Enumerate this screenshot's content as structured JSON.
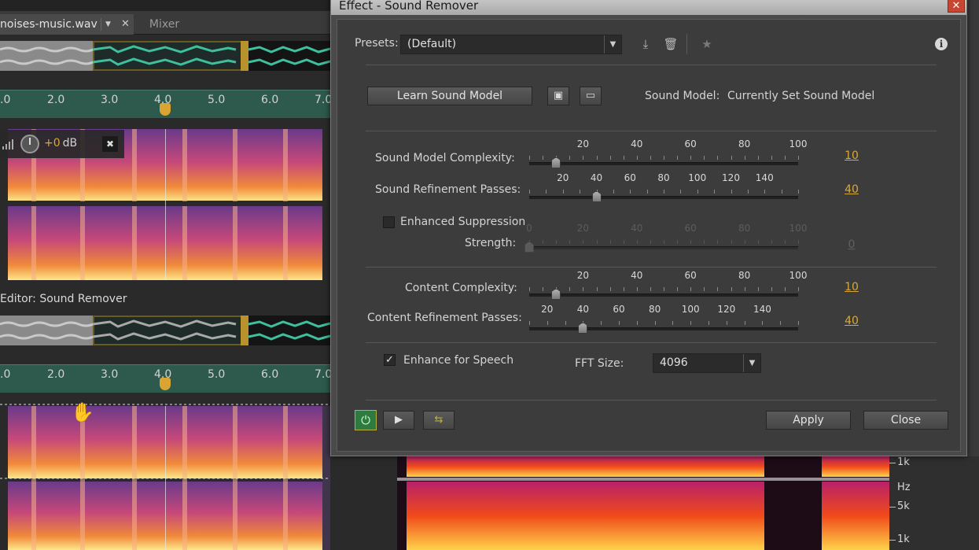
{
  "editor": {
    "file_tab": "noises-music.wav",
    "mixer_tab": "Mixer",
    "panel_title": "Editor: Sound Remover",
    "volume_value": "+0",
    "volume_unit": "dB",
    "ruler_ticks": [
      ".0",
      "2.0",
      "3.0",
      "4.0",
      "5.0",
      "6.0",
      "7.0"
    ],
    "hz_scale": {
      "unit": "Hz",
      "labels": [
        "1k",
        "5k",
        "1k"
      ]
    }
  },
  "dialog": {
    "title": "Effect - Sound Remover",
    "presets_label": "Presets:",
    "presets_value": "(Default)",
    "learn_button": "Learn Sound Model",
    "sound_model_label": "Sound Model:",
    "sound_model_value": "Currently Set Sound Model",
    "sliders": {
      "sound_model_complexity": {
        "label": "Sound Model Complexity:",
        "ticks": [
          "20",
          "40",
          "60",
          "80",
          "100"
        ],
        "min": 0,
        "max": 100,
        "value": "10"
      },
      "sound_refinement_passes": {
        "label": "Sound Refinement Passes:",
        "ticks": [
          "20",
          "40",
          "60",
          "80",
          "100",
          "120",
          "140"
        ],
        "min": 0,
        "max": 160,
        "value": "40"
      },
      "strength": {
        "label": "Strength:",
        "ticks": [
          "0",
          "20",
          "40",
          "60",
          "80",
          "100"
        ],
        "min": 0,
        "max": 100,
        "value": "0"
      },
      "content_complexity": {
        "label": "Content Complexity:",
        "ticks": [
          "20",
          "40",
          "60",
          "80",
          "100"
        ],
        "min": 0,
        "max": 100,
        "value": "10"
      },
      "content_refinement_passes": {
        "label": "Content Refinement Passes:",
        "ticks": [
          "20",
          "40",
          "60",
          "80",
          "100",
          "120",
          "140"
        ],
        "min": 10,
        "max": 160,
        "value": "40"
      }
    },
    "enhanced_suppression": {
      "label": "Enhanced Suppression",
      "checked": false
    },
    "enhance_speech": {
      "label": "Enhance for Speech",
      "checked": true
    },
    "fft_label": "FFT Size:",
    "fft_value": "4096",
    "apply_button": "Apply",
    "close_button": "Close"
  },
  "colors": {
    "accent": "#d7a93a",
    "power": "#2f7a3f"
  },
  "icons": {
    "save_preset": "download-icon",
    "delete_preset": "trash-icon",
    "favorite": "star-icon",
    "info": "info-icon",
    "save_model": "floppy-icon",
    "open_model": "folder-icon",
    "power": "power-icon",
    "play": "play-icon",
    "loop": "loop-icon"
  }
}
